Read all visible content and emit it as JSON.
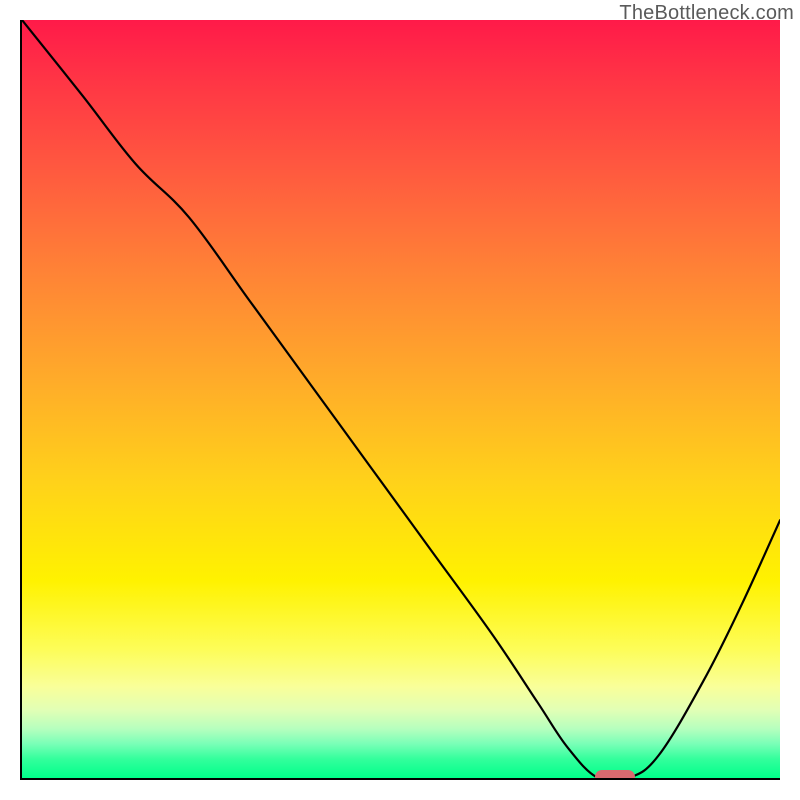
{
  "watermark": "TheBottleneck.com",
  "chart_data": {
    "type": "line",
    "title": "",
    "xlabel": "",
    "ylabel": "",
    "xlim": [
      0,
      100
    ],
    "ylim": [
      0,
      100
    ],
    "grid": false,
    "series": [
      {
        "name": "curve",
        "x": [
          0,
          8,
          15,
          22,
          30,
          38,
          46,
          54,
          62,
          68,
          72,
          76,
          80,
          84,
          90,
          95,
          100
        ],
        "values": [
          100,
          90,
          81,
          74,
          63,
          52,
          41,
          30,
          19,
          10,
          4,
          0,
          0,
          3,
          13,
          23,
          34
        ]
      }
    ],
    "marker": {
      "x": 78,
      "y": 0
    },
    "background_gradient": {
      "orientation": "vertical",
      "stops": [
        {
          "pct": 0,
          "color": "#ff1a49"
        },
        {
          "pct": 20,
          "color": "#ff5a3f"
        },
        {
          "pct": 47,
          "color": "#ffaa2a"
        },
        {
          "pct": 74,
          "color": "#fff200"
        },
        {
          "pct": 92,
          "color": "#c8ffba"
        },
        {
          "pct": 100,
          "color": "#00ff8a"
        }
      ]
    }
  }
}
